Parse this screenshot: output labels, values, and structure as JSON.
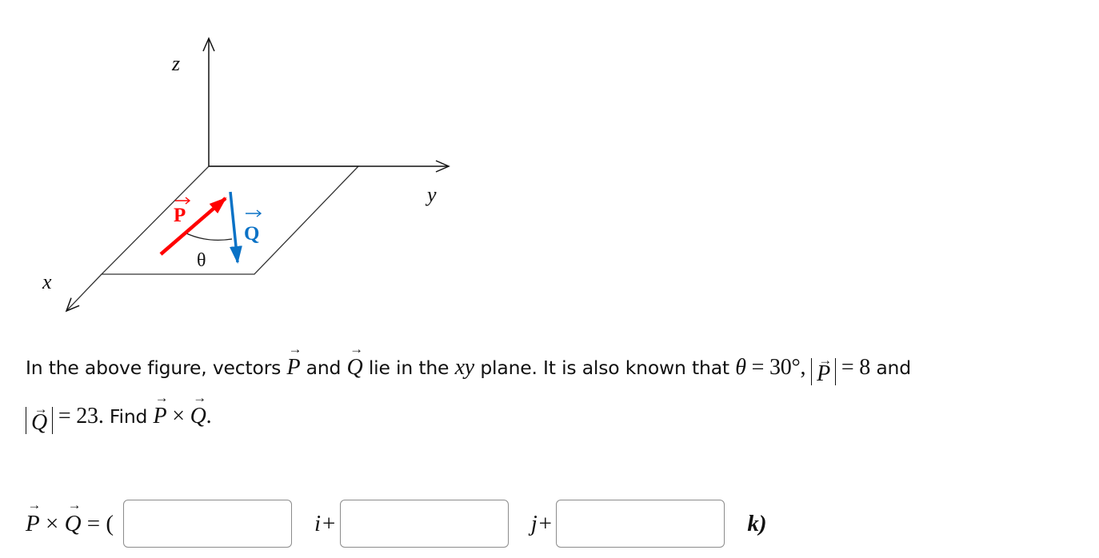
{
  "figure": {
    "axis_labels": {
      "x": "x",
      "y": "y",
      "z": "z"
    },
    "vector_P": {
      "label": "P",
      "color": "#ff0000"
    },
    "vector_Q": {
      "label": "Q",
      "color": "#0a72c6"
    },
    "angle_label": "θ"
  },
  "problem": {
    "line1": {
      "t1": "In the above figure, vectors ",
      "P": "P",
      "t2": " and ",
      "Q": "Q",
      "t3": " lie in the ",
      "xy": "xy",
      "t4": " plane. It is also known that ",
      "theta": "θ",
      "eq1": " = 30°, ",
      "P2": "P",
      "eq2": " = 8",
      "t5": " and"
    },
    "line2": {
      "Q": "Q",
      "eq": " = 23.",
      "t1": " Find ",
      "P": "P",
      "times": " × ",
      "Q2": "Q",
      "end": "."
    }
  },
  "answer": {
    "lhs_P": "P",
    "lhs_times": " × ",
    "lhs_Q": "Q",
    "lhs_eq": " = (",
    "i_value": "",
    "i_label": "i+",
    "j_value": "",
    "j_label": "j+",
    "k_value": "",
    "k_label": "k)"
  }
}
